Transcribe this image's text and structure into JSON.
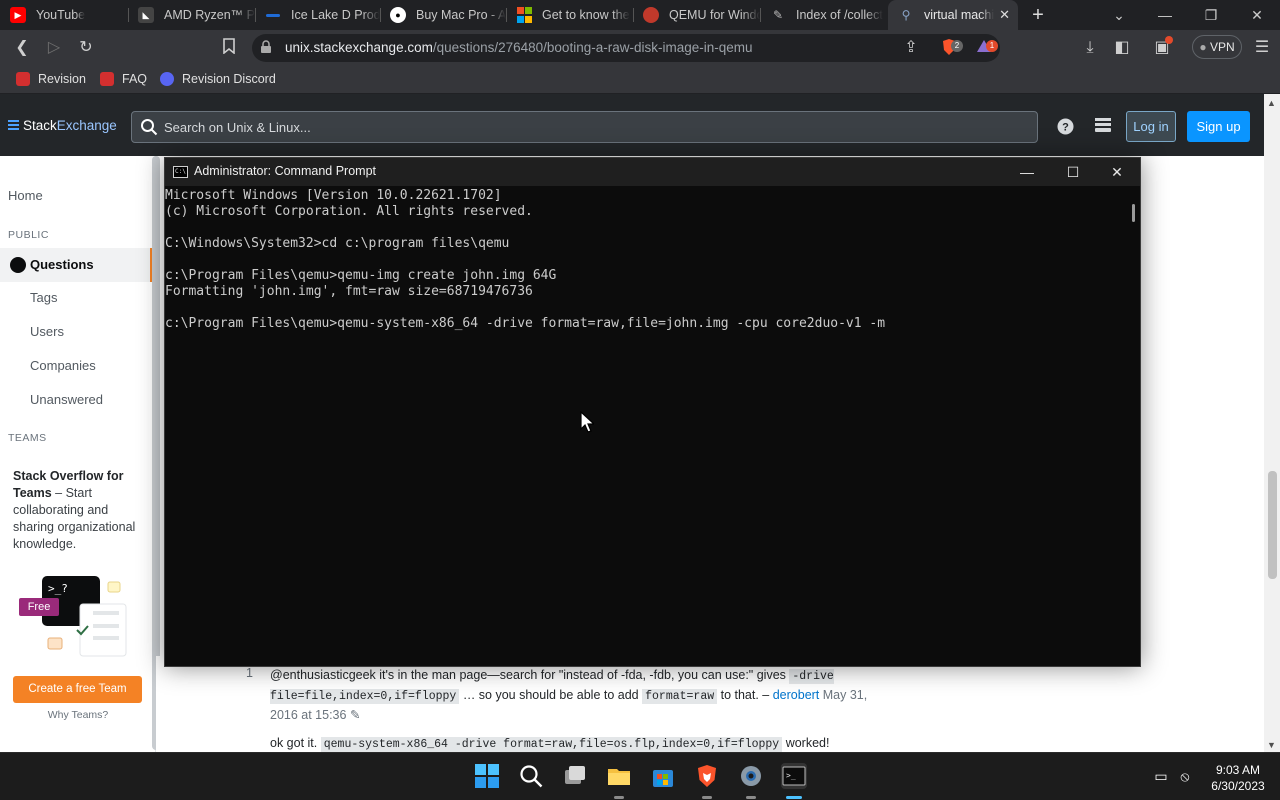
{
  "browser": {
    "tabs": [
      {
        "title": "YouTube",
        "color": "#ff0000"
      },
      {
        "title": "AMD Ryzen™ PR",
        "color": "#444444"
      },
      {
        "title": "Ice Lake D Produ",
        "color": "#1f6bd6"
      },
      {
        "title": "Buy Mac Pro - Ap",
        "color": "#ffffff"
      },
      {
        "title": "Get to know the",
        "color": "#f25022"
      },
      {
        "title": "QEMU for Windo",
        "color": "#c0392b"
      },
      {
        "title": "Index of /collect",
        "color": "#a6a6a6"
      },
      {
        "title": "virtual machi",
        "color": "#8aa4c8"
      }
    ],
    "url_domain": "unix.stackexchange.com",
    "url_path": "/questions/276480/booting-a-raw-disk-image-in-qemu",
    "shield_badge": "2",
    "alert_badge": "1",
    "vpn_label": "VPN",
    "bookmarks": [
      {
        "label": "Revision",
        "color": "#d32f2f"
      },
      {
        "label": "FAQ",
        "color": "#d32f2f"
      },
      {
        "label": "Revision Discord",
        "color": "#5865f2"
      }
    ]
  },
  "site": {
    "logo_stack": "Stack",
    "logo_exchange": "Exchange",
    "search_placeholder": "Search on Unix & Linux...",
    "login_label": "Log in",
    "signup_label": "Sign up",
    "nav": {
      "home": "Home",
      "public_heading": "PUBLIC",
      "questions": "Questions",
      "tags": "Tags",
      "users": "Users",
      "companies": "Companies",
      "unanswered": "Unanswered",
      "teams_heading": "TEAMS"
    },
    "teams": {
      "title": "Stack Overflow for Teams",
      "body": " – Start collaborating and sharing organizational knowledge.",
      "free_badge": "Free",
      "cta": "Create a free Team",
      "why": "Why Teams?"
    },
    "comments": [
      {
        "score": "1",
        "pre": "@enthusiasticgeek it's in the man page—search for \"instead of -fda, -fdb, you can use:\" gives ",
        "code1": "-drive file=file,index=0,if=floppy",
        "mid": " … so you should be able to add ",
        "code2": "format=raw",
        "post": " to that. – ",
        "user": "derobert",
        "date": " May 31, 2016 at 15:36"
      },
      {
        "pre": "ok got it. ",
        "code1": "qemu-system-x86_64 -drive format=raw,file=os.flp,index=0,if=floppy",
        "post": " worked!"
      }
    ]
  },
  "cmd": {
    "title": "Administrator: Command Prompt",
    "lines": [
      "Microsoft Windows [Version 10.0.22621.1702]",
      "(c) Microsoft Corporation. All rights reserved.",
      "",
      "C:\\Windows\\System32>cd c:\\program files\\qemu",
      "",
      "c:\\Program Files\\qemu>qemu-img create john.img 64G",
      "Formatting 'john.img', fmt=raw size=68719476736",
      "",
      "c:\\Program Files\\qemu>qemu-system-x86_64 -drive format=raw,file=john.img -cpu core2duo-v1 -m"
    ]
  },
  "taskbar": {
    "time": "9:03 AM",
    "date": "6/30/2023"
  }
}
